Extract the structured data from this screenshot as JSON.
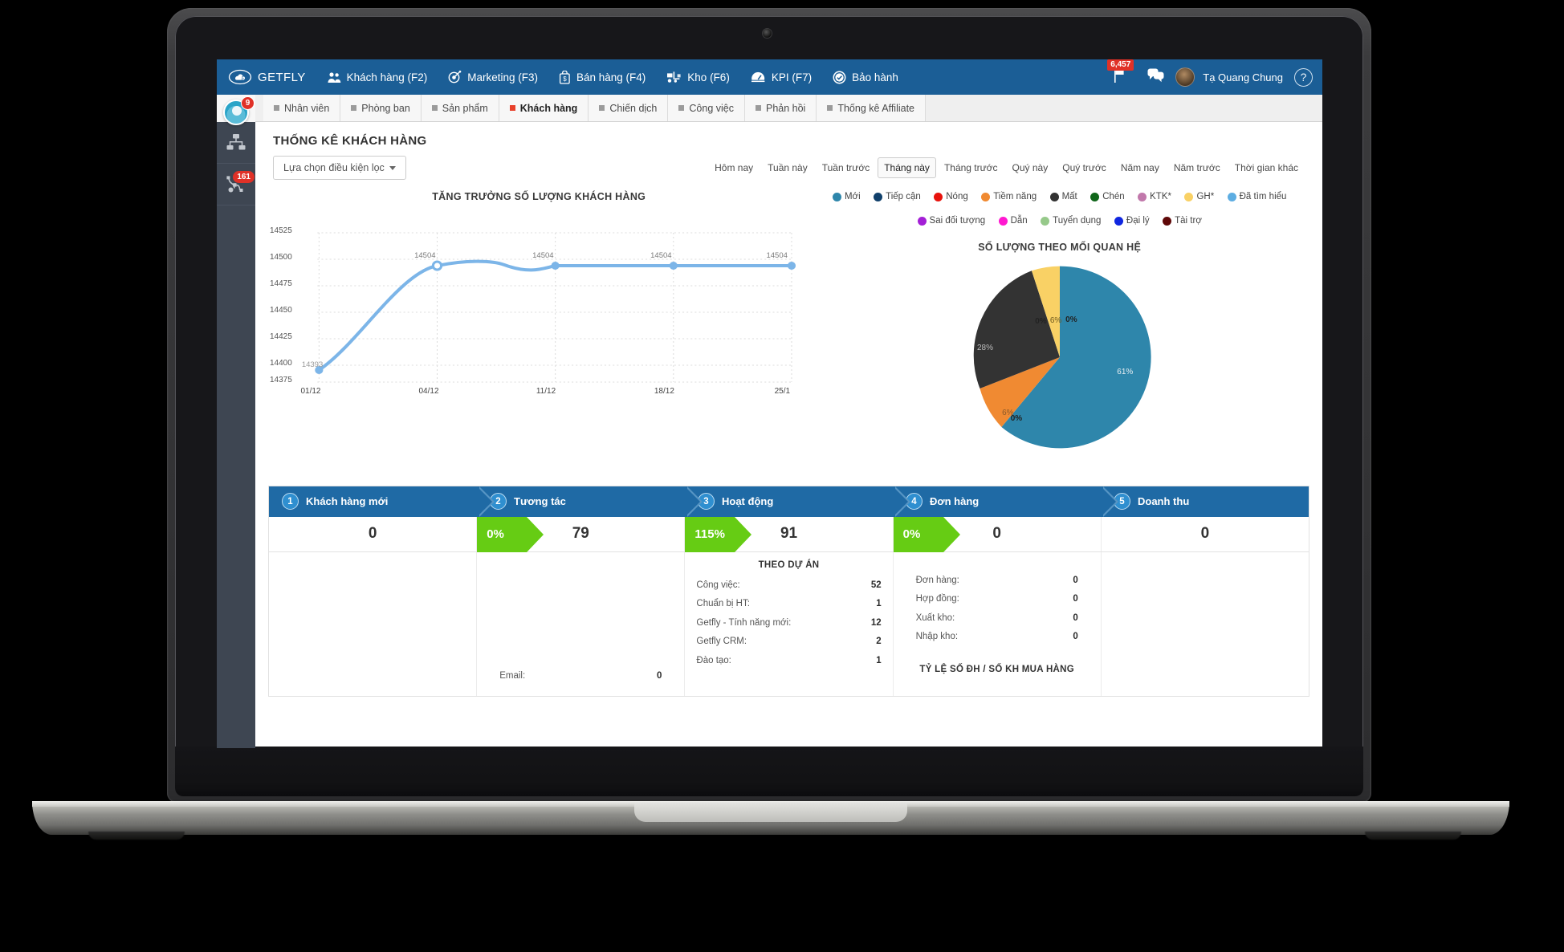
{
  "topnav": {
    "brand": "GETFLY",
    "items": [
      {
        "label": "Khách hàng (F2)",
        "icon": "users-icon"
      },
      {
        "label": "Marketing (F3)",
        "icon": "target-icon"
      },
      {
        "label": "Bán hàng (F4)",
        "icon": "shopping-bag-icon"
      },
      {
        "label": "Kho (F6)",
        "icon": "forklift-icon"
      },
      {
        "label": "KPI (F7)",
        "icon": "gauge-icon"
      },
      {
        "label": "Bảo hành",
        "icon": "check-shield-icon"
      }
    ],
    "flag_badge": "6,457",
    "user_name": "Tạ Quang Chung",
    "help_label": "?"
  },
  "subnav": {
    "tabs": [
      {
        "label": "Nhân viên",
        "active": false
      },
      {
        "label": "Phòng ban",
        "active": false
      },
      {
        "label": "Sản phẩm",
        "active": false
      },
      {
        "label": "Khách hàng",
        "active": true
      },
      {
        "label": "Chiến dịch",
        "active": false
      },
      {
        "label": "Công việc",
        "active": false
      },
      {
        "label": "Phản hồi",
        "active": false
      },
      {
        "label": "Thống kê Affiliate",
        "active": false
      }
    ]
  },
  "rail": {
    "avatar_badge": "9",
    "items": [
      {
        "name": "org-chart-icon",
        "badge": ""
      },
      {
        "name": "workflow-icon",
        "badge": "161"
      }
    ]
  },
  "page": {
    "title": "THỐNG KÊ KHÁCH HÀNG",
    "filter_label": "Lựa chọn điều kiện lọc",
    "ranges": [
      {
        "label": "Hôm nay",
        "active": false
      },
      {
        "label": "Tuần này",
        "active": false
      },
      {
        "label": "Tuần trước",
        "active": false
      },
      {
        "label": "Tháng này",
        "active": true
      },
      {
        "label": "Tháng trước",
        "active": false
      },
      {
        "label": "Quý này",
        "active": false
      },
      {
        "label": "Quý trước",
        "active": false
      },
      {
        "label": "Năm nay",
        "active": false
      },
      {
        "label": "Năm trước",
        "active": false
      },
      {
        "label": "Thời gian khác",
        "active": false
      }
    ]
  },
  "legend": {
    "row1": [
      {
        "label": "Mới",
        "color": "#2e86ab"
      },
      {
        "label": "Tiếp cận",
        "color": "#10406b"
      },
      {
        "label": "Nóng",
        "color": "#e8120c"
      },
      {
        "label": "Tiềm năng",
        "color": "#f08a32"
      },
      {
        "label": "Mất",
        "color": "#333333"
      },
      {
        "label": "Chén",
        "color": "#10661a"
      },
      {
        "label": "KTK*",
        "color": "#c178ab"
      },
      {
        "label": "GH*",
        "color": "#f9d165"
      },
      {
        "label": "Đã tìm hiểu",
        "color": "#5dade2"
      }
    ],
    "row2": [
      {
        "label": "Sai đối tượng",
        "color": "#a31fd6"
      },
      {
        "label": "Dẫn",
        "color": "#ff18d0"
      },
      {
        "label": "Tuyển dụng",
        "color": "#96c98a"
      },
      {
        "label": "Đại lý",
        "color": "#0f26e0"
      },
      {
        "label": "Tài trợ",
        "color": "#5f0808"
      }
    ]
  },
  "chart_data": [
    {
      "type": "line",
      "title": "TĂNG TRƯỞNG SỐ LƯỢNG KHÁCH HÀNG",
      "xlabel": "",
      "ylabel": "",
      "x": [
        "01/12",
        "04/12",
        "11/12",
        "18/12",
        "25/1"
      ],
      "values": [
        14393,
        14504,
        14504,
        14504,
        14504
      ],
      "point_labels": [
        "14393",
        "14504",
        "14504",
        "14504",
        "14504"
      ],
      "yticks": [
        14375,
        14400,
        14425,
        14450,
        14475,
        14500,
        14525
      ],
      "ylim": [
        14375,
        14525
      ],
      "grid": true,
      "series_color": "#7cb5e8",
      "legend_position": "none"
    },
    {
      "type": "pie",
      "title": "SỐ LƯỢNG THEO MỐI QUAN HỆ",
      "categories": [
        "Mới",
        "Tiềm năng",
        "Mất",
        "GH*",
        "Tiếp cận",
        "Nóng"
      ],
      "values": [
        61,
        6,
        28,
        6,
        0,
        0
      ],
      "labels": [
        "61%",
        "6%",
        "28%",
        "6%",
        "0%",
        "0%"
      ],
      "colors": [
        "#2e86ab",
        "#f08a32",
        "#333333",
        "#f9d165",
        "#10406b",
        "#e8120c"
      ],
      "legend_position": "top"
    }
  ],
  "funnel": {
    "steps": [
      {
        "num": "1",
        "label": "Khách hàng mới",
        "value": "0",
        "pct": ""
      },
      {
        "num": "2",
        "label": "Tương tác",
        "value": "79",
        "pct": "0%"
      },
      {
        "num": "3",
        "label": "Hoạt động",
        "value": "91",
        "pct": "115%"
      },
      {
        "num": "4",
        "label": "Đơn hàng",
        "value": "0",
        "pct": "0%"
      },
      {
        "num": "5",
        "label": "Doanh thu",
        "value": "0",
        "pct": ""
      }
    ]
  },
  "details": {
    "col2": {
      "rows": [
        {
          "label": "Email:",
          "value": "0"
        }
      ]
    },
    "col3": {
      "title": "THEO DỰ ÁN",
      "rows": [
        {
          "label": "Công việc:",
          "value": "52"
        },
        {
          "label": "Chuẩn bị HT:",
          "value": "1"
        },
        {
          "label": "Getfly - Tính năng mới:",
          "value": "12"
        },
        {
          "label": "Getfly CRM:",
          "value": "2"
        },
        {
          "label": "Đào tạo:",
          "value": "1"
        }
      ]
    },
    "col4": {
      "rows": [
        {
          "label": "Đơn hàng:",
          "value": "0"
        },
        {
          "label": "Hợp đồng:",
          "value": "0"
        },
        {
          "label": "Xuất kho:",
          "value": "0"
        },
        {
          "label": "Nhập kho:",
          "value": "0"
        }
      ],
      "footer_title": "TỶ LỆ SỐ ĐH / SỐ KH MUA HÀNG"
    }
  }
}
